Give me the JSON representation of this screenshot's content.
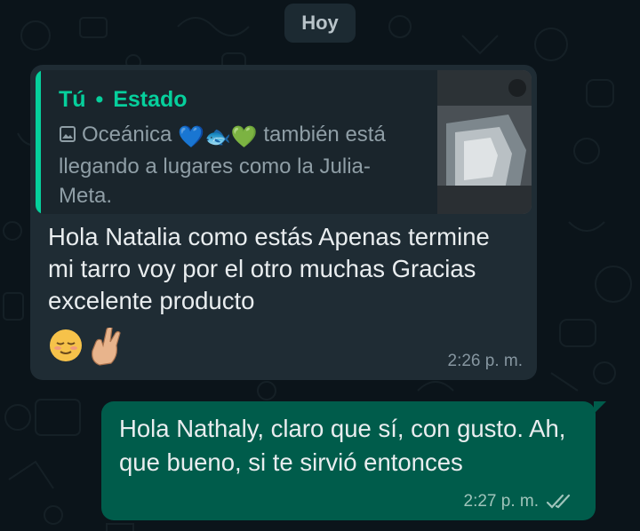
{
  "date_chip": {
    "label": "Hoy"
  },
  "incoming": {
    "quote": {
      "author": "Tú",
      "separator": "•",
      "context": "Estado",
      "text_prefix": "Oceánica",
      "text_emoji": "💙🐟💚",
      "text_suffix": "también está llegando a lugares como la Julia-Meta.",
      "media_icon": "image-icon"
    },
    "text": "Hola Natalia como estás Apenas termine mi tarro voy por el otro muchas Gracias excelente producto",
    "emojis": [
      "😌",
      "🤞"
    ],
    "time": "2:26 p. m."
  },
  "outgoing": {
    "text": "Hola Nathaly, claro que sí, con gusto. Ah, que bueno, si te sirvió entonces",
    "time": "2:27 p. m.",
    "status_icon": "double-check-icon"
  },
  "colors": {
    "background": "#0b141a",
    "incoming_bubble": "#1f2c34",
    "outgoing_bubble": "#005c4b",
    "accent": "#06cf9c"
  }
}
